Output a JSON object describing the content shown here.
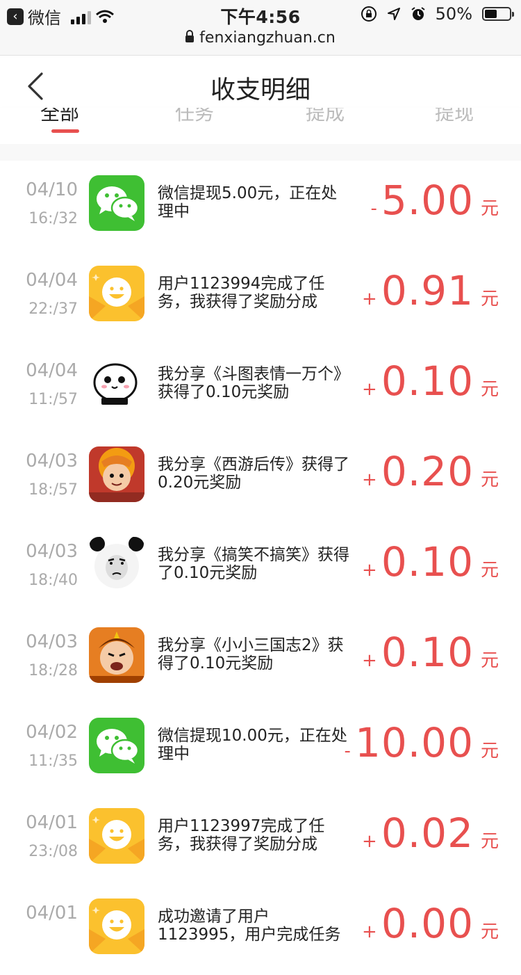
{
  "status": {
    "back_app": "微信",
    "time": "下午4:56",
    "battery": "50%",
    "battery_level": 0.5
  },
  "url": "fenxiangzhuan.cn",
  "nav": {
    "title": "收支明细"
  },
  "tabs": [
    "全部",
    "任务",
    "提成",
    "提现"
  ],
  "records": [
    {
      "date": "04/10",
      "time": "16:/32",
      "icon": "wechat-icon",
      "desc": "微信提现5.00元，正在处理中",
      "sign": "-",
      "amount": "5.00",
      "unit": "元"
    },
    {
      "date": "04/04",
      "time": "22:/37",
      "icon": "smiley-icon",
      "desc": "用户1123994完成了任务，我获得了奖励分成",
      "sign": "+",
      "amount": "0.91",
      "unit": "元"
    },
    {
      "date": "04/04",
      "time": "11:/57",
      "icon": "meme-face-icon",
      "desc": "我分享《斗图表情一万个》获得了0.10元奖励",
      "sign": "+",
      "amount": "0.10",
      "unit": "元"
    },
    {
      "date": "04/03",
      "time": "18:/57",
      "icon": "xiyou-game-icon",
      "desc": "我分享《西游后传》获得了0.20元奖励",
      "sign": "+",
      "amount": "0.20",
      "unit": "元"
    },
    {
      "date": "04/03",
      "time": "18:/40",
      "icon": "panda-meme-icon",
      "desc": "我分享《搞笑不搞笑》获得了0.10元奖励",
      "sign": "+",
      "amount": "0.10",
      "unit": "元"
    },
    {
      "date": "04/03",
      "time": "18:/28",
      "icon": "sanguo-game-icon",
      "desc": "我分享《小小三国志2》获得了0.10元奖励",
      "sign": "+",
      "amount": "0.10",
      "unit": "元"
    },
    {
      "date": "04/02",
      "time": "11:/35",
      "icon": "wechat-icon",
      "desc": "微信提现10.00元，正在处理中",
      "sign": "-",
      "amount": "10.00",
      "unit": "元"
    },
    {
      "date": "04/01",
      "time": "23:/08",
      "icon": "smiley-icon",
      "desc": "用户1123997完成了任务，我获得了奖励分成",
      "sign": "+",
      "amount": "0.02",
      "unit": "元"
    },
    {
      "date": "04/01",
      "time": "",
      "icon": "smiley-icon",
      "desc": "成功邀请了用户1123995，用户完成任务",
      "sign": "+",
      "amount": "0.00",
      "unit": "元"
    }
  ],
  "colors": {
    "accent": "#e8504f",
    "wechat": "#3fbf33",
    "smiley": "#fbc12e"
  }
}
